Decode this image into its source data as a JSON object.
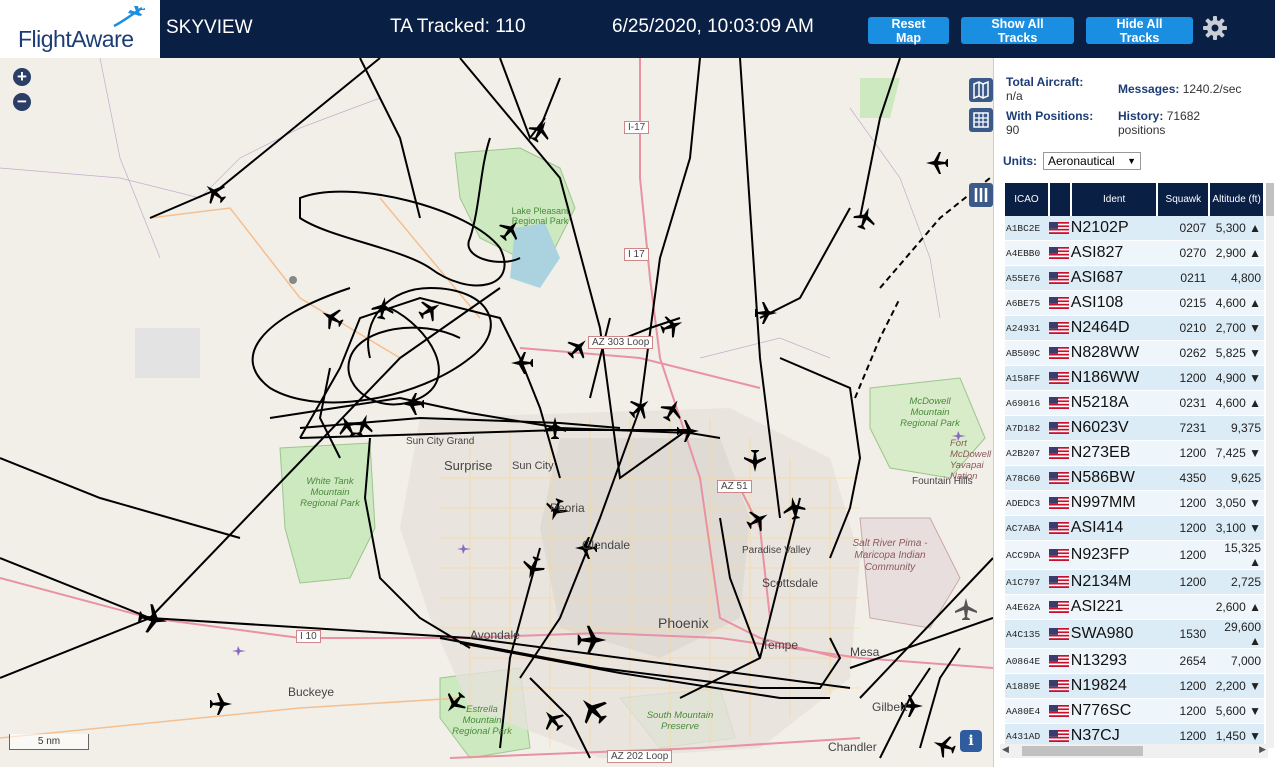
{
  "header": {
    "logo_text": "FlightAware",
    "app_title": "SKYVIEW",
    "ta_tracked": "TA Tracked: 110",
    "datetime": "6/25/2020, 10:03:09 AM",
    "reset_map": "Reset Map",
    "show_all_tracks": "Show All Tracks",
    "hide_all_tracks": "Hide All Tracks",
    "settings_icon": "gear-icon"
  },
  "map": {
    "zoom_in": "+",
    "zoom_out": "−",
    "scale": "5 nm",
    "info": "i",
    "labels": {
      "i17": "I-17",
      "i17b": "I 17",
      "lake_pleasant": "Lake Pleasant Regional Park",
      "az303": "AZ 303 Loop",
      "white_tank": "White Tank Mountain Regional Park",
      "sun_city_grand": "Sun City Grand",
      "surprise": "Surprise",
      "sun_city": "Sun City",
      "glendale": "Glendale",
      "az51": "AZ 51",
      "paradise_valley": "Paradise Valley",
      "scottsdale": "Scottsdale",
      "mcdowell": "McDowell Mountain Regional Park",
      "fort_mcdowell": "Fort McDowell Yavapai Nation",
      "fountain_hills": "Fountain Hills",
      "salt_river": "Salt River Pima - Maricopa Indian Community",
      "i10": "I 10",
      "avondale": "Avondale",
      "phoenix": "Phoenix",
      "tempe": "Tempe",
      "mesa": "Mesa",
      "buckeye": "Buckeye",
      "estrella": "Estrella Mountain Regional Park",
      "south_mountain": "South Mountain Preserve",
      "gilbert": "Gilbert",
      "chandler": "Chandler",
      "az202": "AZ 202 Loop",
      "peoria": "Peoria"
    }
  },
  "stats": {
    "total_aircraft_label": "Total Aircraft:",
    "total_aircraft_value": "n/a",
    "messages_label": "Messages:",
    "messages_value": "1240.2/sec",
    "with_positions_label": "With Positions:",
    "with_positions_value": "90",
    "history_label": "History:",
    "history_value": "71682",
    "history_unit": "positions",
    "units_label": "Units:",
    "units_value": "Aeronautical"
  },
  "table": {
    "headers": [
      "ICAO",
      "",
      "Ident",
      "Squawk",
      "Altitude (ft)"
    ],
    "rows": [
      {
        "icao": "A1BC2E",
        "ident": "N2102P",
        "squawk": "0207",
        "alt": "5,300 ▲"
      },
      {
        "icao": "A4EBB0",
        "ident": "ASI827",
        "squawk": "0270",
        "alt": "2,900 ▲"
      },
      {
        "icao": "A55E76",
        "ident": "ASI687",
        "squawk": "0211",
        "alt": "4,800"
      },
      {
        "icao": "A6BE75",
        "ident": "ASI108",
        "squawk": "0215",
        "alt": "4,600 ▲"
      },
      {
        "icao": "A24931",
        "ident": "N2464D",
        "squawk": "0210",
        "alt": "2,700 ▼"
      },
      {
        "icao": "AB509C",
        "ident": "N828WW",
        "squawk": "0262",
        "alt": "5,825 ▼"
      },
      {
        "icao": "A158FF",
        "ident": "N186WW",
        "squawk": "1200",
        "alt": "4,900 ▼"
      },
      {
        "icao": "A69016",
        "ident": "N5218A",
        "squawk": "0231",
        "alt": "4,600 ▲"
      },
      {
        "icao": "A7D182",
        "ident": "N6023V",
        "squawk": "7231",
        "alt": "9,375"
      },
      {
        "icao": "A2B207",
        "ident": "N273EB",
        "squawk": "1200",
        "alt": "7,425 ▼"
      },
      {
        "icao": "A78C60",
        "ident": "N586BW",
        "squawk": "4350",
        "alt": "9,625"
      },
      {
        "icao": "ADEDC3",
        "ident": "N997MM",
        "squawk": "1200",
        "alt": "3,050 ▼"
      },
      {
        "icao": "AC7ABA",
        "ident": "ASI414",
        "squawk": "1200",
        "alt": "3,100 ▼"
      },
      {
        "icao": "ACC9DA",
        "ident": "N923FP",
        "squawk": "1200",
        "alt": "15,325 ▲"
      },
      {
        "icao": "A1C797",
        "ident": "N2134M",
        "squawk": "1200",
        "alt": "2,725"
      },
      {
        "icao": "A4E62A",
        "ident": "ASI221",
        "squawk": "",
        "alt": "2,600 ▲"
      },
      {
        "icao": "A4C135",
        "ident": "SWA980",
        "squawk": "1530",
        "alt": "29,600 ▲"
      },
      {
        "icao": "A0864E",
        "ident": "N13293",
        "squawk": "2654",
        "alt": "7,000"
      },
      {
        "icao": "A1889E",
        "ident": "N19824",
        "squawk": "1200",
        "alt": "2,200 ▼"
      },
      {
        "icao": "AA80E4",
        "ident": "N776SC",
        "squawk": "1200",
        "alt": "5,600 ▼"
      },
      {
        "icao": "A431AD",
        "ident": "N37CJ",
        "squawk": "1200",
        "alt": "1,450 ▼"
      }
    ]
  }
}
